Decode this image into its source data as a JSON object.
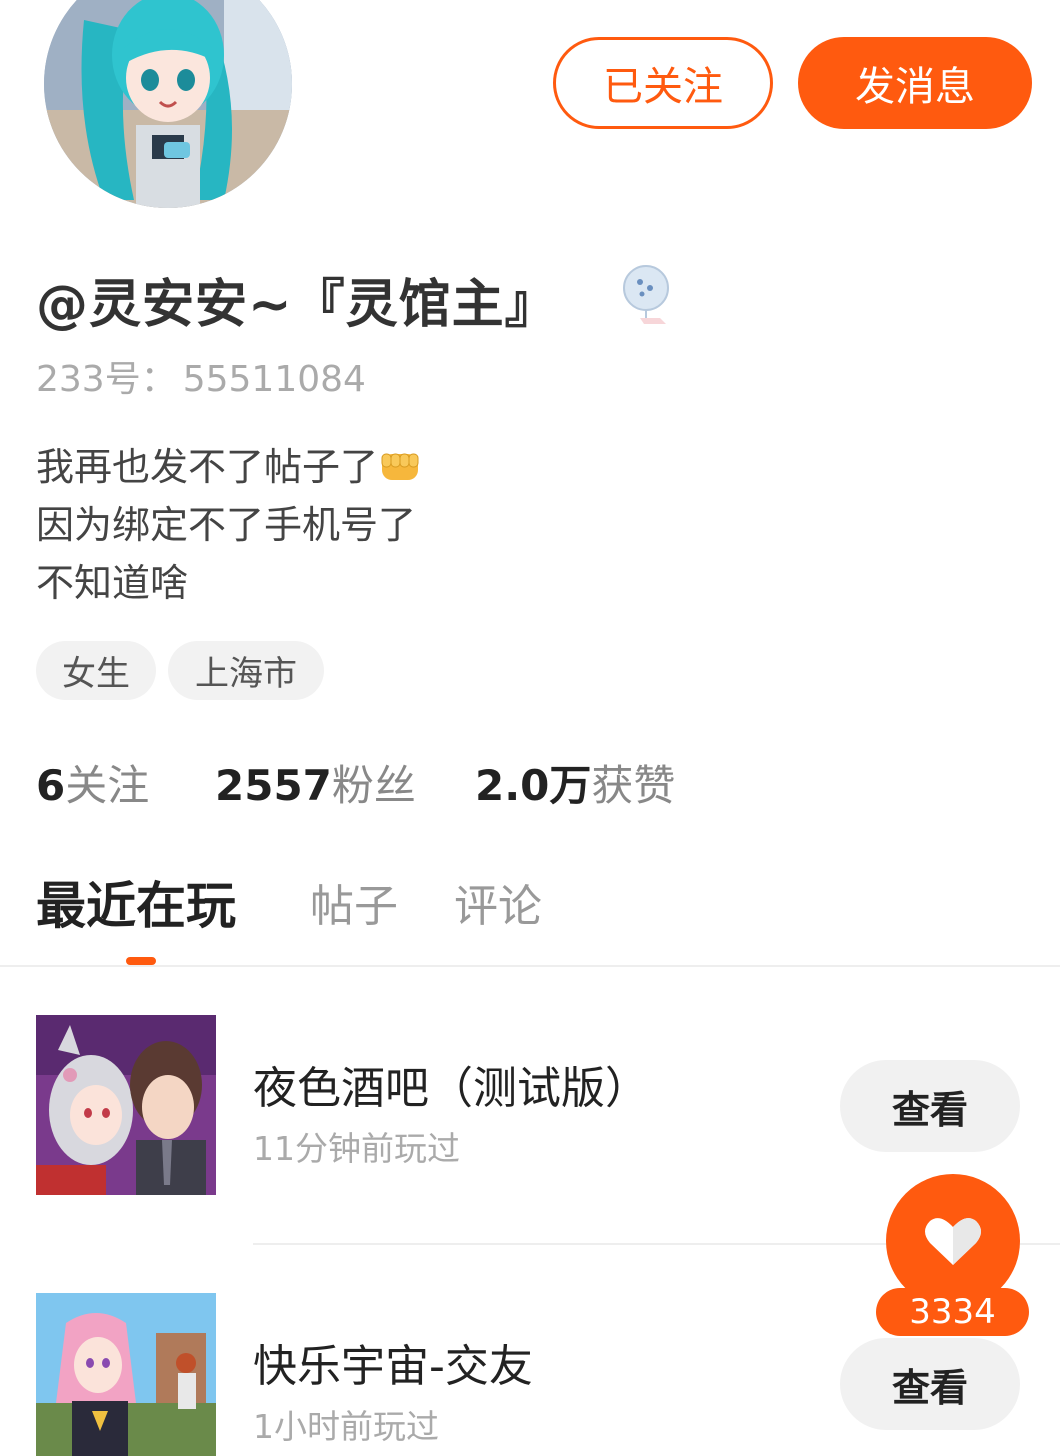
{
  "profile": {
    "username": "@灵安安~『灵馆主』",
    "uid_label": "233号：",
    "uid_value": "55511084",
    "bio_lines": [
      "我再也发不了帖子了",
      "因为绑定不了手机号了",
      "不知道啥"
    ],
    "tags": [
      "女生",
      "上海市"
    ],
    "badge_icon": "wind-chime-badge-icon",
    "avatar_icon": "anime-avatar"
  },
  "actions": {
    "followed_label": "已关注",
    "message_label": "发消息"
  },
  "stats": {
    "following_num": "6",
    "following_label": "关注",
    "fans_num": "2557",
    "fans_label": "粉丝",
    "likes_num": "2.0万",
    "likes_label": "获赞"
  },
  "tabs": {
    "items": [
      "最近在玩",
      "帖子",
      "评论"
    ],
    "active_index": 0
  },
  "games": [
    {
      "title": "夜色酒吧（测试版）",
      "time": "11分钟前玩过",
      "action": "查看"
    },
    {
      "title": "快乐宇宙-交友",
      "time": "1小时前玩过",
      "action": "查看"
    }
  ],
  "like_fab": {
    "count": "3334",
    "icon": "heart-icon"
  },
  "colors": {
    "accent": "#ff5a0f",
    "muted": "#aaaaaa",
    "chip_bg": "#f2f2f2"
  }
}
